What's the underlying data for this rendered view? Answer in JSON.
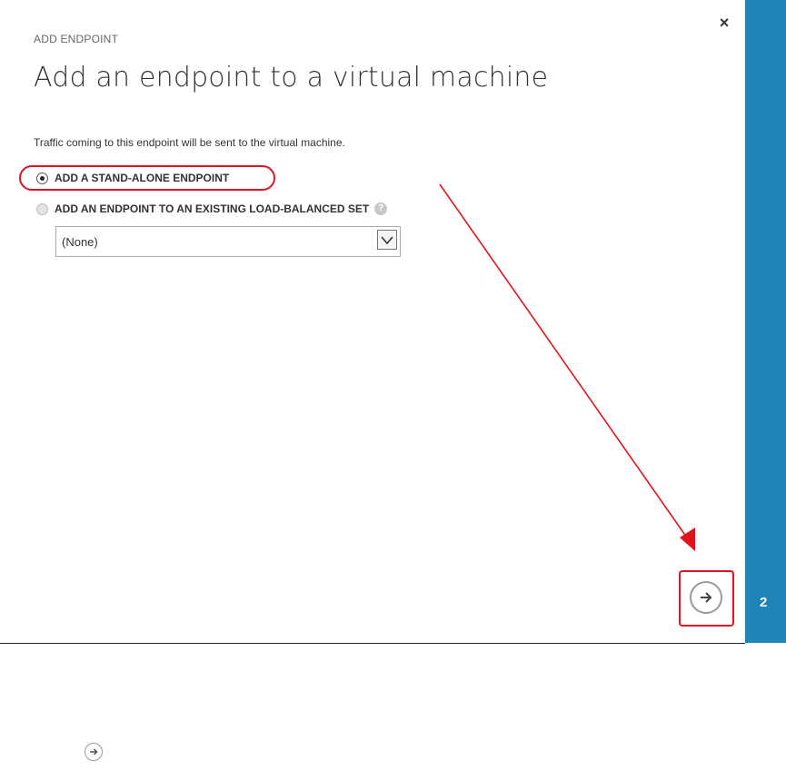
{
  "dialog": {
    "subtitle": "ADD ENDPOINT",
    "title": "Add an endpoint to a virtual machine",
    "description": "Traffic coming to this endpoint will be sent to the virtual machine.",
    "options": [
      {
        "label": "ADD A STAND-ALONE ENDPOINT",
        "selected": true
      },
      {
        "label": "ADD AN ENDPOINT TO AN EXISTING LOAD-BALANCED SET",
        "selected": false
      }
    ],
    "help_glyph": "?",
    "load_balanced_set_select": {
      "value": "(None)"
    },
    "close_glyph": "×",
    "next_icon": "arrow-right-icon"
  },
  "sidebar": {
    "step_number": "2",
    "color": "#1f84b6"
  },
  "annotation_color": "#e0141e"
}
